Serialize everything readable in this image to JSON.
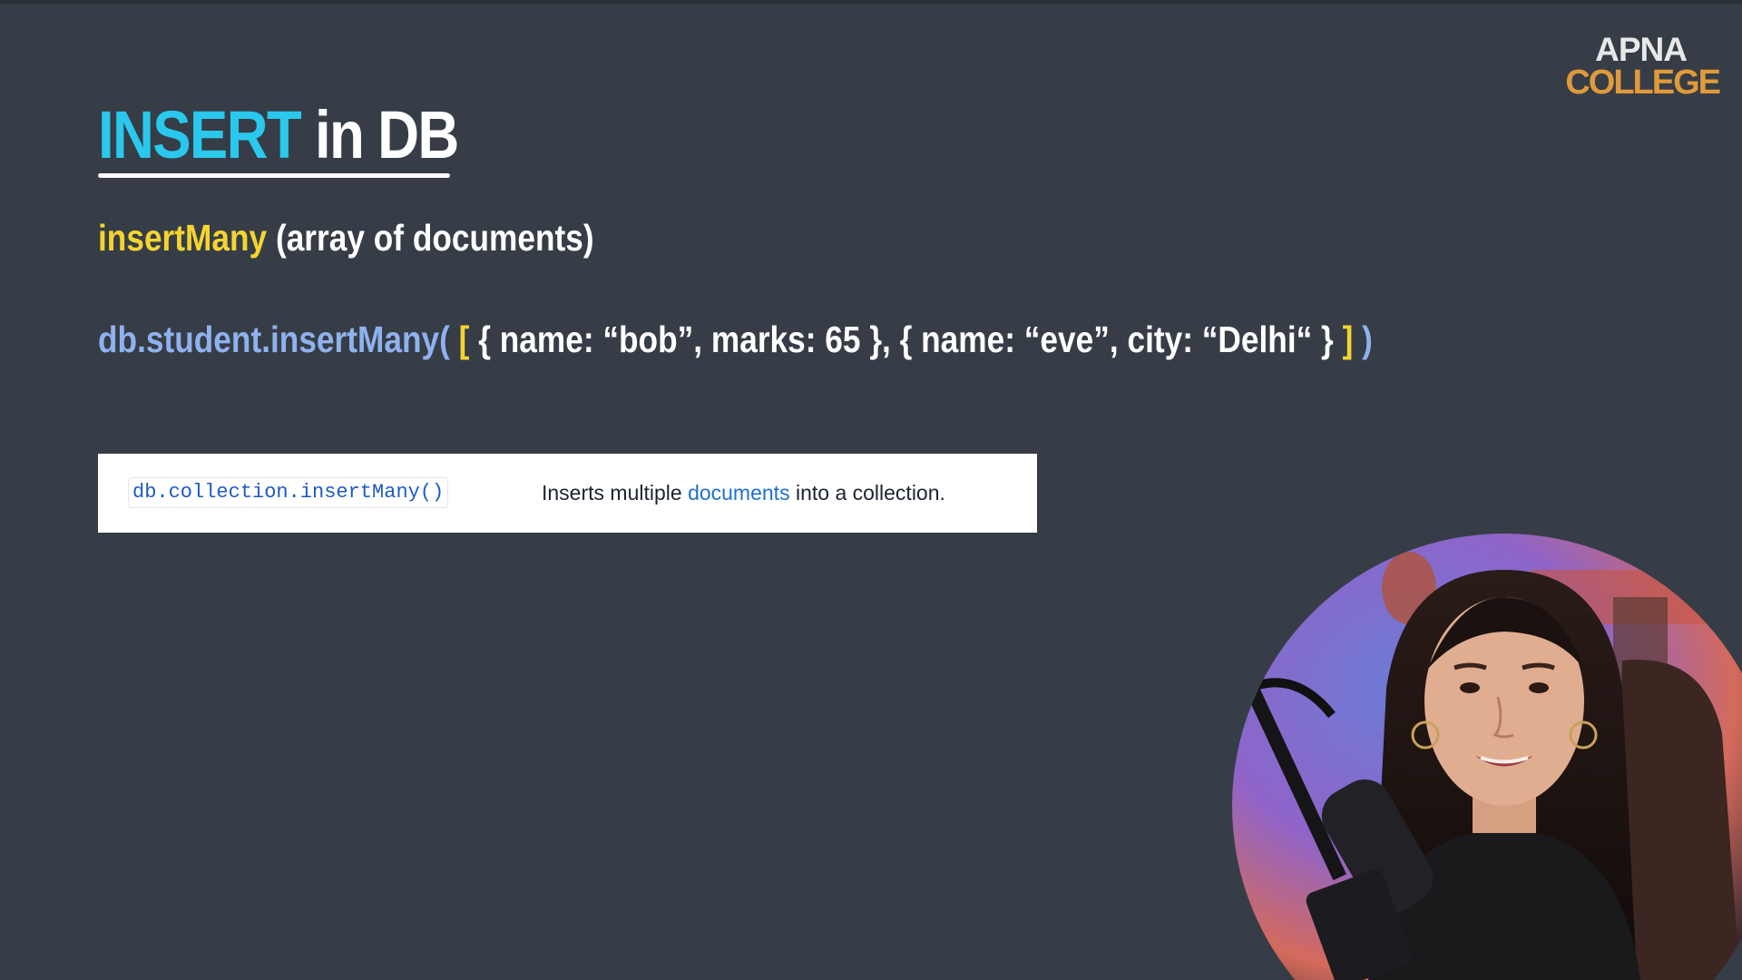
{
  "slide": {
    "title_keyword": "INSERT",
    "title_rest": " in DB",
    "subtitle_method": "insertMany",
    "subtitle_desc": " (array of documents)",
    "code": {
      "call": "db.student.insertMany( ",
      "open_bracket": "[",
      "args": " { name: “bob”, marks: 65 }, { name: “eve”, city: “Delhi“ } ",
      "close_bracket": "]",
      "close_paren": " )"
    }
  },
  "doc_reference": {
    "method": "db.collection.insertMany()",
    "desc_before": "Inserts multiple ",
    "desc_link": "documents",
    "desc_after": " into a collection."
  },
  "logo": {
    "line1": "APNA",
    "line2": "COLLEGE"
  },
  "colors": {
    "background": "#363d47",
    "title_keyword": "#29c8ec",
    "method_highlight": "#f5d430",
    "code_call": "#8fb2ee",
    "link": "#1f6fd1",
    "logo_accent": "#e09a3a"
  },
  "presenter": {
    "icon": "presenter-webcam"
  }
}
